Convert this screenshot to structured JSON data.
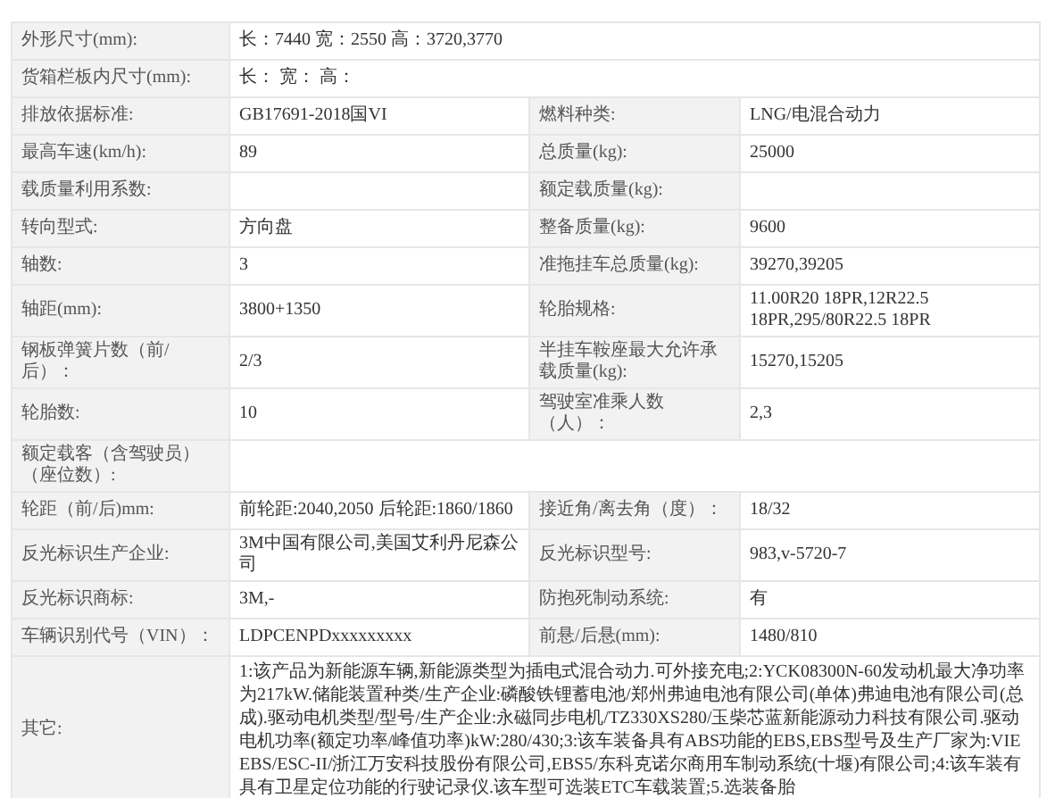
{
  "rows": [
    {
      "pairs": [
        {
          "label": "外形尺寸(mm):",
          "value": "长：7440 宽：2550 高：3720,3770"
        }
      ]
    },
    {
      "pairs": [
        {
          "label": "货箱栏板内尺寸(mm):",
          "value": "长： 宽： 高："
        }
      ]
    },
    {
      "pairs": [
        {
          "label": "排放依据标准:",
          "value": "GB17691-2018国VI"
        },
        {
          "label": "燃料种类:",
          "value": "LNG/电混合动力"
        }
      ]
    },
    {
      "pairs": [
        {
          "label": "最高车速(km/h):",
          "value": "89"
        },
        {
          "label": "总质量(kg):",
          "value": "25000"
        }
      ]
    },
    {
      "pairs": [
        {
          "label": "载质量利用系数:"
        },
        {
          "label": "额定载质量(kg):"
        }
      ]
    },
    {
      "pairs": [
        {
          "label": "转向型式:",
          "value": "方向盘"
        },
        {
          "label": "整备质量(kg):",
          "value": "9600"
        }
      ]
    },
    {
      "pairs": [
        {
          "label": "轴数:",
          "value": "3"
        },
        {
          "label": "准拖挂车总质量(kg):",
          "value": "39270,39205"
        }
      ]
    },
    {
      "pairs": [
        {
          "label": "轴距(mm):",
          "value": "3800+1350"
        },
        {
          "label": "轮胎规格:",
          "value": "11.00R20 18PR,12R22.5 18PR,295/80R22.5 18PR"
        }
      ]
    },
    {
      "pairs": [
        {
          "label": "钢板弹簧片数（前/后）：",
          "value": "2/3"
        },
        {
          "label": "半挂车鞍座最大允许承载质量(kg):",
          "value": "15270,15205"
        }
      ]
    },
    {
      "pairs": [
        {
          "label": "轮胎数:",
          "value": "10"
        },
        {
          "label": "驾驶室准乘人数（人）：",
          "value": "2,3"
        }
      ]
    },
    {
      "pairs": [
        {
          "label": "额定载客（含驾驶员）（座位数）:"
        }
      ]
    },
    {
      "pairs": [
        {
          "label": "轮距（前/后)mm:",
          "value": "前轮距:2040,2050 后轮距:1860/1860"
        },
        {
          "label": "接近角/离去角（度）：",
          "value": "18/32"
        }
      ]
    },
    {
      "pairs": [
        {
          "label": "反光标识生产企业:",
          "value": "3M中国有限公司,美国艾利丹尼森公司"
        },
        {
          "label": "反光标识型号:",
          "value": "983,v-5720-7"
        }
      ]
    },
    {
      "pairs": [
        {
          "label": "反光标识商标:",
          "value": "3M,-"
        },
        {
          "label": "防抱死制动系统:",
          "value": "有"
        }
      ]
    },
    {
      "pairs": [
        {
          "label": "车辆识别代号（VIN）：",
          "value": "LDPCENPDxxxxxxxxx"
        },
        {
          "label": "前悬/后悬(mm):",
          "value": "1480/810"
        }
      ]
    },
    {
      "pairs": [
        {
          "label": "其它:",
          "value": "1:该产品为新能源车辆,新能源类型为插电式混合动力.可外接充电;2:YCK08300N-60发动机最大净功率为217kW.储能装置种类/生产企业:磷酸铁锂蓄电池/郑州弗迪电池有限公司(单体)弗迪电池有限公司(总成).驱动电机类型/型号/生产企业:永磁同步电机/TZ330XS280/玉柴芯蓝新能源动力科技有限公司.驱动电机功率(额定功率/峰值功率)kW:280/430;3:该车装备具有ABS功能的EBS,EBS型号及生产厂家为:VIE EBS/ESC-II/浙江万安科技股份有限公司,EBS5/东科克诺尔商用车制动系统(十堰)有限公司;4:该车装有具有卫星定位功能的行驶记录仪.该车型可选装ETC车载装置;5.选装备胎"
        }
      ]
    }
  ]
}
